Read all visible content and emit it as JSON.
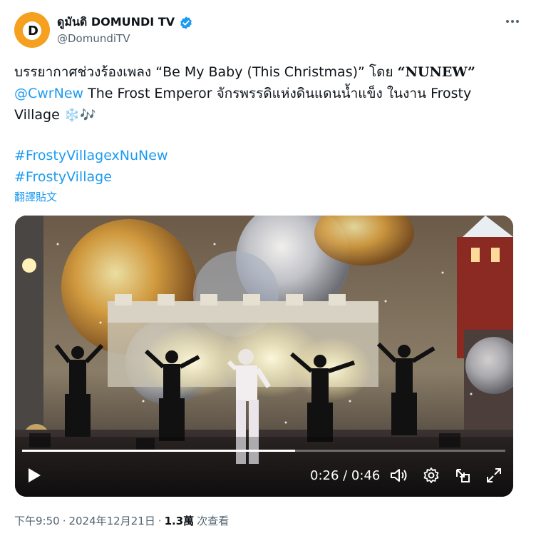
{
  "author": {
    "display_name": "ดูมันดิ DOMUNDI TV",
    "handle": "@DomundiTV",
    "avatar_letter": "D",
    "verified": true
  },
  "tweet": {
    "line1_prefix": "บรรยากาศช่วงร้องเพลง “Be My Baby (This Christmas)” โดย ",
    "line1_bold": "“NUNEW”",
    "mention": "@CwrNew",
    "line2_rest": " The Frost Emperor จักรพรรดิแห่งดินแดนน้ำแข็ง ในงาน Frosty",
    "line3": "Village ",
    "emoji": "❄️🎶",
    "hashtags": [
      "#FrostyVillagexNuNew",
      "#FrostyVillage"
    ],
    "translate_label": "翻譯貼文"
  },
  "video": {
    "current_time": "0:26",
    "duration": "0:46",
    "time_display": "0:26 / 0:46",
    "progress_fraction": 0.565
  },
  "meta": {
    "time": "下午9:50",
    "sep1": "·",
    "date": "2024年12月21日",
    "sep2": "·",
    "views": "1.3萬",
    "views_label": "次查看"
  },
  "colors": {
    "link": "#1d9bf0",
    "muted": "#536471",
    "avatar_bg": "#f5a01f"
  }
}
